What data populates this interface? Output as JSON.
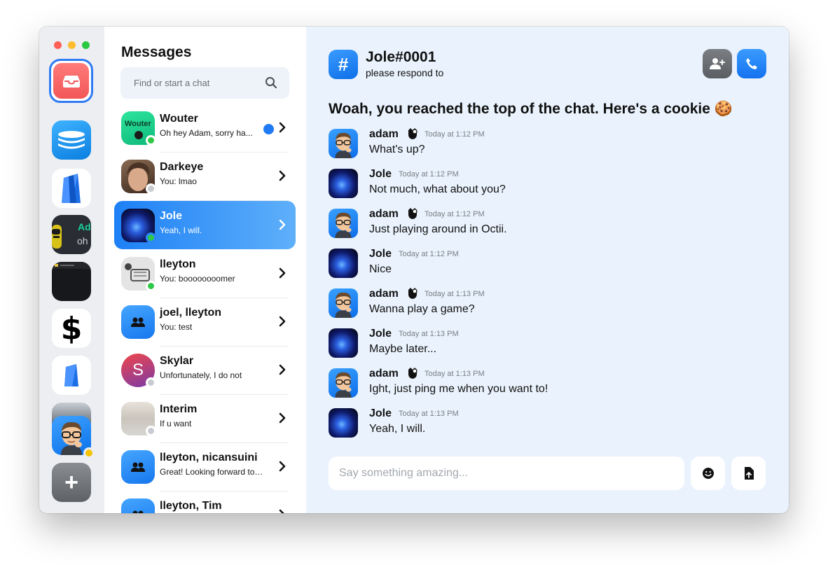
{
  "window": {
    "traffic_lights": [
      "close",
      "minimize",
      "zoom"
    ]
  },
  "rail": {
    "servers": [
      {
        "name": "inbox",
        "icon": "inbox-tray-icon",
        "selected": true
      },
      {
        "name": "database",
        "icon": "database-icon"
      },
      {
        "name": "shop",
        "icon": "shopping-bag-icon"
      },
      {
        "name": "among-us",
        "icon": "among-us-icon",
        "snippet_top": "Ad",
        "snippet_bottom": "oh"
      },
      {
        "name": "dark-app",
        "icon": "dark-window-icon"
      },
      {
        "name": "dollar",
        "icon": "dollar-icon",
        "glyph": "$"
      },
      {
        "name": "shop-2",
        "icon": "shopping-bag-icon"
      },
      {
        "name": "profile",
        "icon": "memoji-icon",
        "status": "idle"
      },
      {
        "name": "add-server",
        "icon": "plus-icon",
        "glyph": "+"
      }
    ]
  },
  "conversations": {
    "title": "Messages",
    "search_placeholder": "Find or start a chat",
    "items": [
      {
        "name": "Wouter",
        "preview": "Oh hey Adam, sorry ha...",
        "status": "online",
        "unread": true,
        "avatar_label": "Wouter",
        "avatar": "wouter"
      },
      {
        "name": "Darkeye",
        "preview": "You: lmao",
        "status": "offline",
        "avatar": "photo-face"
      },
      {
        "name": "Jole",
        "preview": "Yeah, I will.",
        "status": "online",
        "active": true,
        "avatar": "galaxy"
      },
      {
        "name": "lleyton",
        "preview": "You: boooooooomer",
        "status": "online",
        "avatar": "sketch"
      },
      {
        "name": "joel, lleyton",
        "preview": "You: test",
        "avatar": "group"
      },
      {
        "name": "Skylar",
        "preview": "Unfortunately, I do not",
        "status": "offline",
        "avatar": "letter",
        "avatar_letter": "S"
      },
      {
        "name": "Interim",
        "preview": "If u want",
        "status": "offline",
        "avatar": "landscape"
      },
      {
        "name": "lleyton, nicansuini",
        "preview": "Great! Looking forward to ...",
        "avatar": "group"
      },
      {
        "name": "lleyton, Tim",
        "preview": "",
        "avatar": "group"
      }
    ]
  },
  "chat": {
    "channel_icon": "#",
    "channel_name": "Jole#0001",
    "channel_topic": "please respond to",
    "top_message": "Woah, you reached the top of the chat. Here's a cookie 🍪",
    "messages": [
      {
        "author": "adam",
        "badge": true,
        "time": "Today at 1:12 PM",
        "text": "What's up?",
        "avatar": "memoji"
      },
      {
        "author": "Jole",
        "time": "Today at 1:12 PM",
        "text": "Not much, what about you?",
        "avatar": "galaxy"
      },
      {
        "author": "adam",
        "badge": true,
        "time": "Today at 1:12 PM",
        "text": "Just playing around in Octii.",
        "avatar": "memoji"
      },
      {
        "author": "Jole",
        "time": "Today at 1:12 PM",
        "text": "Nice",
        "avatar": "galaxy"
      },
      {
        "author": "adam",
        "badge": true,
        "time": "Today at 1:13 PM",
        "text": "Wanna play a game?",
        "avatar": "memoji"
      },
      {
        "author": "Jole",
        "time": "Today at 1:13 PM",
        "text": "Maybe later...",
        "avatar": "galaxy"
      },
      {
        "author": "adam",
        "badge": true,
        "time": "Today at 1:13 PM",
        "text": "Ight, just ping me when you want to!",
        "avatar": "memoji"
      },
      {
        "author": "Jole",
        "time": "Today at 1:13 PM",
        "text": "Yeah, I will.",
        "avatar": "galaxy"
      }
    ],
    "composer_placeholder": "Say something amazing...",
    "buttons": {
      "emoji": "emoji-icon",
      "file": "file-upload-icon",
      "add_user": "add-user-icon",
      "call": "phone-icon"
    }
  },
  "colors": {
    "accent": "#1f7af4",
    "online": "#2fc94a",
    "offline": "#c8ccd1",
    "idle": "#f5c400",
    "chat_bg": "#eaf3fd",
    "inbox": "#f25757"
  }
}
